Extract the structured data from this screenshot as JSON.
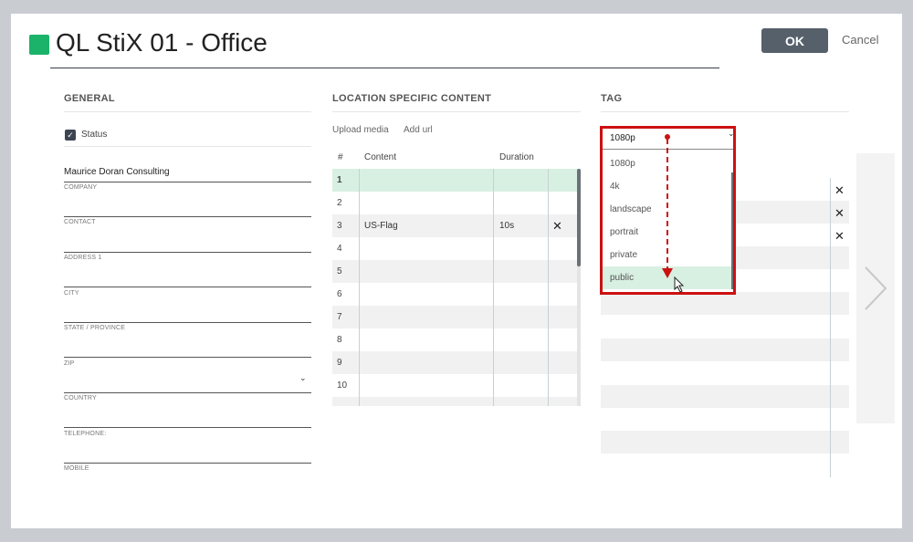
{
  "header": {
    "title": "QL StiX 01 - Office",
    "status_color": "#1bb36a",
    "ok_label": "OK",
    "cancel_label": "Cancel"
  },
  "general": {
    "heading": "GENERAL",
    "status_label": "Status",
    "status_checked": true,
    "fields": [
      {
        "label": "COMPANY",
        "value": "Maurice Doran Consulting"
      },
      {
        "label": "CONTACT",
        "value": ""
      },
      {
        "label": "ADDRESS 1",
        "value": ""
      },
      {
        "label": "CITY",
        "value": ""
      },
      {
        "label": "STATE / PROVINCE",
        "value": ""
      },
      {
        "label": "ZIP",
        "value": ""
      },
      {
        "label": "COUNTRY",
        "value": ""
      },
      {
        "label": "TELEPHONE:",
        "value": ""
      },
      {
        "label": "MOBILE",
        "value": ""
      }
    ]
  },
  "location": {
    "heading": "LOCATION SPECIFIC CONTENT",
    "upload_label": "Upload media",
    "add_url_label": "Add url",
    "columns": {
      "num": "#",
      "content": "Content",
      "duration": "Duration"
    },
    "rows": [
      {
        "num": "1",
        "content": "",
        "duration": ""
      },
      {
        "num": "2",
        "content": "",
        "duration": ""
      },
      {
        "num": "3",
        "content": "US-Flag",
        "duration": "10s"
      },
      {
        "num": "4",
        "content": "",
        "duration": ""
      },
      {
        "num": "5",
        "content": "",
        "duration": ""
      },
      {
        "num": "6",
        "content": "",
        "duration": ""
      },
      {
        "num": "7",
        "content": "",
        "duration": ""
      },
      {
        "num": "8",
        "content": "",
        "duration": ""
      },
      {
        "num": "9",
        "content": "",
        "duration": ""
      },
      {
        "num": "10",
        "content": "",
        "duration": ""
      }
    ]
  },
  "tag": {
    "heading": "TAG",
    "selected": "1080p",
    "options": [
      "1080p",
      "4k",
      "landscape",
      "portrait",
      "private",
      "public"
    ],
    "highlighted": "public"
  },
  "icons": {
    "checkbox": "check-icon",
    "remove": "close-icon",
    "chevron": "chevron-down-icon",
    "next": "chevron-right-icon",
    "annotation": "dashed-arrow-down",
    "cursor": "mouse-pointer-icon"
  },
  "colors": {
    "ok_button": "#56606b",
    "highlight_row": "#d8f0e2",
    "annotation": "#cc1111"
  }
}
